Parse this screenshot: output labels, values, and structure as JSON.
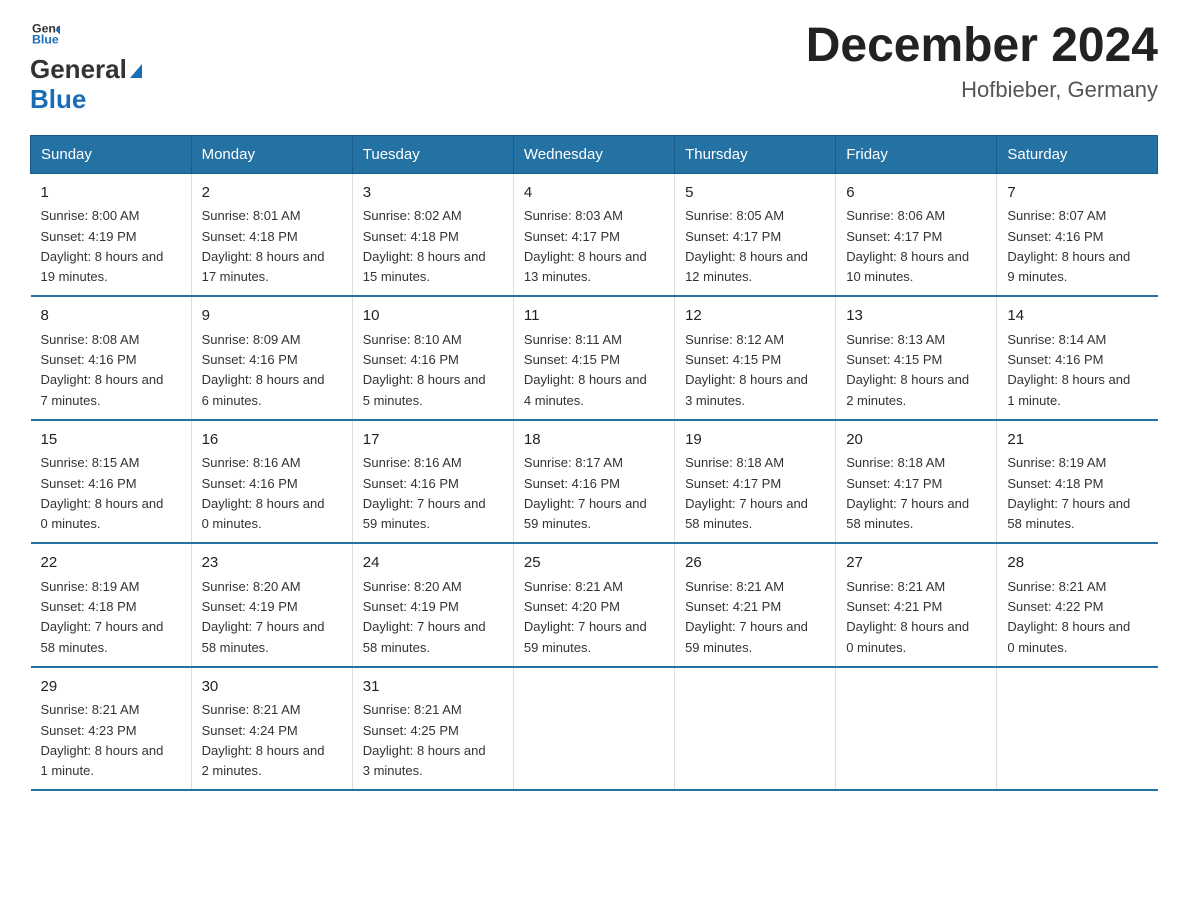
{
  "header": {
    "logo_text_general": "General",
    "logo_text_blue": "Blue",
    "title": "December 2024",
    "subtitle": "Hofbieber, Germany"
  },
  "days_of_week": [
    "Sunday",
    "Monday",
    "Tuesday",
    "Wednesday",
    "Thursday",
    "Friday",
    "Saturday"
  ],
  "weeks": [
    [
      {
        "day": "1",
        "sunrise": "8:00 AM",
        "sunset": "4:19 PM",
        "daylight": "8 hours and 19 minutes."
      },
      {
        "day": "2",
        "sunrise": "8:01 AM",
        "sunset": "4:18 PM",
        "daylight": "8 hours and 17 minutes."
      },
      {
        "day": "3",
        "sunrise": "8:02 AM",
        "sunset": "4:18 PM",
        "daylight": "8 hours and 15 minutes."
      },
      {
        "day": "4",
        "sunrise": "8:03 AM",
        "sunset": "4:17 PM",
        "daylight": "8 hours and 13 minutes."
      },
      {
        "day": "5",
        "sunrise": "8:05 AM",
        "sunset": "4:17 PM",
        "daylight": "8 hours and 12 minutes."
      },
      {
        "day": "6",
        "sunrise": "8:06 AM",
        "sunset": "4:17 PM",
        "daylight": "8 hours and 10 minutes."
      },
      {
        "day": "7",
        "sunrise": "8:07 AM",
        "sunset": "4:16 PM",
        "daylight": "8 hours and 9 minutes."
      }
    ],
    [
      {
        "day": "8",
        "sunrise": "8:08 AM",
        "sunset": "4:16 PM",
        "daylight": "8 hours and 7 minutes."
      },
      {
        "day": "9",
        "sunrise": "8:09 AM",
        "sunset": "4:16 PM",
        "daylight": "8 hours and 6 minutes."
      },
      {
        "day": "10",
        "sunrise": "8:10 AM",
        "sunset": "4:16 PM",
        "daylight": "8 hours and 5 minutes."
      },
      {
        "day": "11",
        "sunrise": "8:11 AM",
        "sunset": "4:15 PM",
        "daylight": "8 hours and 4 minutes."
      },
      {
        "day": "12",
        "sunrise": "8:12 AM",
        "sunset": "4:15 PM",
        "daylight": "8 hours and 3 minutes."
      },
      {
        "day": "13",
        "sunrise": "8:13 AM",
        "sunset": "4:15 PM",
        "daylight": "8 hours and 2 minutes."
      },
      {
        "day": "14",
        "sunrise": "8:14 AM",
        "sunset": "4:16 PM",
        "daylight": "8 hours and 1 minute."
      }
    ],
    [
      {
        "day": "15",
        "sunrise": "8:15 AM",
        "sunset": "4:16 PM",
        "daylight": "8 hours and 0 minutes."
      },
      {
        "day": "16",
        "sunrise": "8:16 AM",
        "sunset": "4:16 PM",
        "daylight": "8 hours and 0 minutes."
      },
      {
        "day": "17",
        "sunrise": "8:16 AM",
        "sunset": "4:16 PM",
        "daylight": "7 hours and 59 minutes."
      },
      {
        "day": "18",
        "sunrise": "8:17 AM",
        "sunset": "4:16 PM",
        "daylight": "7 hours and 59 minutes."
      },
      {
        "day": "19",
        "sunrise": "8:18 AM",
        "sunset": "4:17 PM",
        "daylight": "7 hours and 58 minutes."
      },
      {
        "day": "20",
        "sunrise": "8:18 AM",
        "sunset": "4:17 PM",
        "daylight": "7 hours and 58 minutes."
      },
      {
        "day": "21",
        "sunrise": "8:19 AM",
        "sunset": "4:18 PM",
        "daylight": "7 hours and 58 minutes."
      }
    ],
    [
      {
        "day": "22",
        "sunrise": "8:19 AM",
        "sunset": "4:18 PM",
        "daylight": "7 hours and 58 minutes."
      },
      {
        "day": "23",
        "sunrise": "8:20 AM",
        "sunset": "4:19 PM",
        "daylight": "7 hours and 58 minutes."
      },
      {
        "day": "24",
        "sunrise": "8:20 AM",
        "sunset": "4:19 PM",
        "daylight": "7 hours and 58 minutes."
      },
      {
        "day": "25",
        "sunrise": "8:21 AM",
        "sunset": "4:20 PM",
        "daylight": "7 hours and 59 minutes."
      },
      {
        "day": "26",
        "sunrise": "8:21 AM",
        "sunset": "4:21 PM",
        "daylight": "7 hours and 59 minutes."
      },
      {
        "day": "27",
        "sunrise": "8:21 AM",
        "sunset": "4:21 PM",
        "daylight": "8 hours and 0 minutes."
      },
      {
        "day": "28",
        "sunrise": "8:21 AM",
        "sunset": "4:22 PM",
        "daylight": "8 hours and 0 minutes."
      }
    ],
    [
      {
        "day": "29",
        "sunrise": "8:21 AM",
        "sunset": "4:23 PM",
        "daylight": "8 hours and 1 minute."
      },
      {
        "day": "30",
        "sunrise": "8:21 AM",
        "sunset": "4:24 PM",
        "daylight": "8 hours and 2 minutes."
      },
      {
        "day": "31",
        "sunrise": "8:21 AM",
        "sunset": "4:25 PM",
        "daylight": "8 hours and 3 minutes."
      },
      null,
      null,
      null,
      null
    ]
  ],
  "labels": {
    "sunrise": "Sunrise:",
    "sunset": "Sunset:",
    "daylight": "Daylight:"
  }
}
